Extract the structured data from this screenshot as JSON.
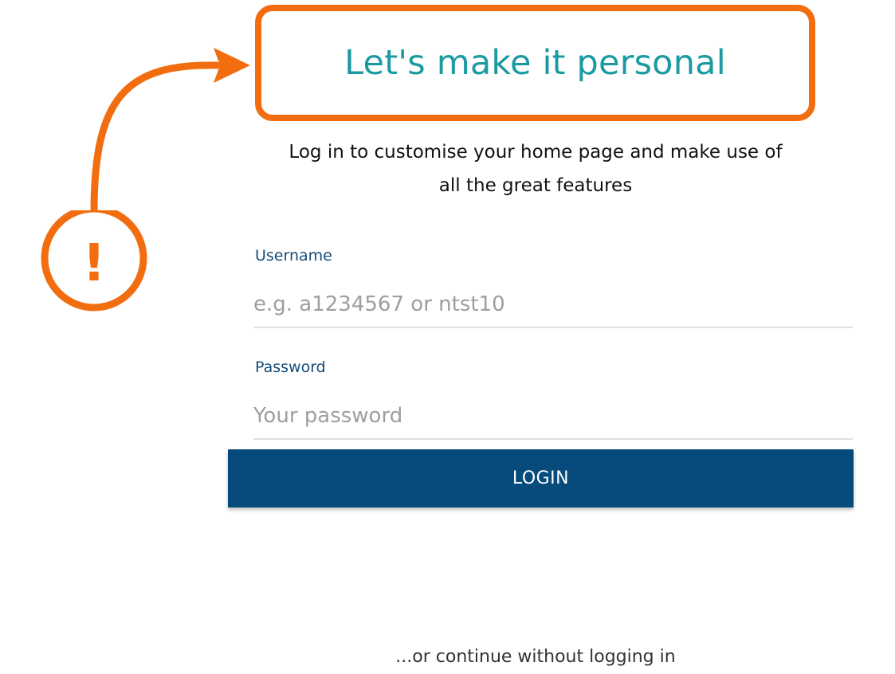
{
  "login_panel": {
    "title": "Let's make it personal",
    "subtitle_line1": "Log in to customise your home page and make use of",
    "subtitle_line2": "all the great features",
    "username": {
      "label": "Username",
      "placeholder": "e.g. a1234567 or ntst10",
      "value": ""
    },
    "password": {
      "label": "Password",
      "placeholder": "Your password",
      "value": ""
    },
    "login_label": "LOGIN",
    "continue_text": "...or continue without logging in"
  },
  "annotation": {
    "alert_symbol": "!",
    "icon": "exclamation-icon",
    "highlight_color": "#f26d0f"
  },
  "colors": {
    "title": "#1a9ba1",
    "field_label": "#164b78",
    "button_background": "#064b7b"
  }
}
